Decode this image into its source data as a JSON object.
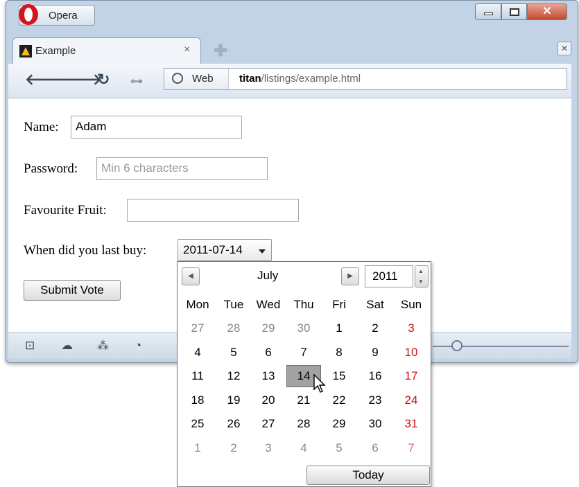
{
  "window": {
    "app_button_label": "Opera",
    "colors": {
      "frame": "#c3d3e6",
      "close": "#c24a30",
      "sunday": "#cc1111"
    }
  },
  "tabs": [
    {
      "label": "Example",
      "close_glyph": "×",
      "favicon": "page-favicon-icon"
    }
  ],
  "toolbar": {
    "icons": [
      "back-arrow-icon",
      "forward-arrow-icon",
      "reload-icon",
      "key-icon"
    ],
    "address_prefix": "Web",
    "url_host": "titan",
    "url_path": "/listings/example.html"
  },
  "form": {
    "name_label": "Name:",
    "name_value": "Adam",
    "password_label": "Password:",
    "password_placeholder": "Min 6 characters",
    "fruit_label": "Favourite Fruit:",
    "fruit_value": "",
    "date_label": "When did you last buy:",
    "date_value": "2011-07-14",
    "submit_label": "Submit Vote"
  },
  "statusbar": {
    "icons": [
      "panel-icon",
      "cloud-icon",
      "unite-icon",
      "speed-dial-icon"
    ]
  },
  "calendar": {
    "month": "July",
    "year": "2011",
    "weekdays": [
      "Mon",
      "Tue",
      "Wed",
      "Thu",
      "Fri",
      "Sat",
      "Sun"
    ],
    "weeks": [
      [
        "27",
        "28",
        "29",
        "30",
        "1",
        "2",
        "3"
      ],
      [
        "4",
        "5",
        "6",
        "7",
        "8",
        "9",
        "10"
      ],
      [
        "11",
        "12",
        "13",
        "14",
        "15",
        "16",
        "17"
      ],
      [
        "18",
        "19",
        "20",
        "21",
        "22",
        "23",
        "24"
      ],
      [
        "25",
        "26",
        "27",
        "28",
        "29",
        "30",
        "31"
      ],
      [
        "1",
        "2",
        "3",
        "4",
        "5",
        "6",
        "7"
      ]
    ],
    "selected_day": "14",
    "today_label": "Today"
  }
}
